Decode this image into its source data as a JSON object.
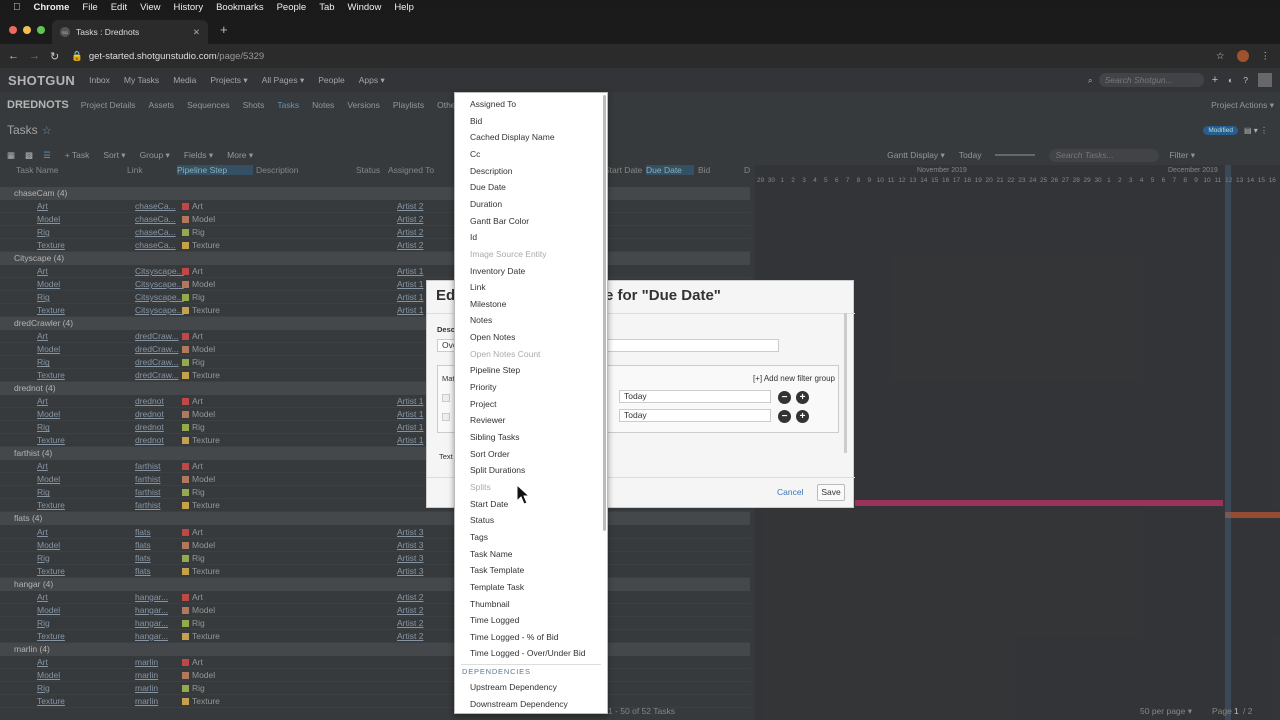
{
  "macbar": {
    "apple": "",
    "app": "Chrome",
    "items": [
      "File",
      "Edit",
      "View",
      "History",
      "Bookmarks",
      "People",
      "Tab",
      "Window",
      "Help"
    ]
  },
  "browser": {
    "tab_title": "Tasks : Drednots",
    "tab_favicon": "SG",
    "url_host": "get-started.shotgunstudio.com",
    "url_path": "/page/5329"
  },
  "topnav": {
    "logo": "SHOTGUN",
    "items": [
      "Inbox",
      "My Tasks",
      "Media",
      "Projects ▾",
      "All Pages ▾",
      "People",
      "Apps ▾"
    ],
    "search_placeholder": "Search Shotgun..."
  },
  "projnav": {
    "project": "DREDNOTS",
    "items": [
      "Project Details",
      "Assets",
      "Sequences",
      "Shots",
      "Tasks",
      "Notes",
      "Versions",
      "Playlists",
      "Othe"
    ],
    "actions": "Project Actions ▾"
  },
  "page": {
    "title": "Tasks",
    "badge": "Modified"
  },
  "toolbar": {
    "items": [
      "+ Task",
      "Sort ▾",
      "Group ▾",
      "Fields ▾",
      "More ▾"
    ],
    "gantt": "Gantt Display ▾",
    "today": "Today",
    "search_placeholder": "Search Tasks...",
    "filter": "Filter ▾"
  },
  "columns": [
    "Task Name",
    "Link",
    "Pipeline Step",
    "Description",
    "Status",
    "Assigned To",
    "Start Date",
    "Due Date",
    "Bid",
    "D"
  ],
  "groups": [
    {
      "name": "chaseCam (4)",
      "link": "chaseCa...",
      "artists": [
        "Artist 2",
        "Artist 2",
        "Artist 2",
        "Artist 2"
      ]
    },
    {
      "name": "Cityscape (4)",
      "link": "Citsyscape...",
      "artists": [
        "Artist 1",
        "Artist 1",
        "Artist 1",
        "Artist 1"
      ]
    },
    {
      "name": "dredCrawler (4)",
      "link": "dredCraw...",
      "artists": [
        "",
        "",
        "",
        ""
      ]
    },
    {
      "name": "drednot (4)",
      "link": "drednot",
      "artists": [
        "Artist 1",
        "Artist 1",
        "Artist 1",
        "Artist 1"
      ]
    },
    {
      "name": "farthist (4)",
      "link": "farthist",
      "artists": [
        "",
        "",
        "",
        ""
      ]
    },
    {
      "name": "flats (4)",
      "link": "flats",
      "artists": [
        "Artist 3",
        "Artist 3",
        "Artist 3",
        "Artist 3"
      ]
    },
    {
      "name": "hangar (4)",
      "link": "hangar...",
      "artists": [
        "Artist 2",
        "Artist 2",
        "Artist 2",
        "Artist 2"
      ]
    },
    {
      "name": "marlin (4)",
      "link": "marlin",
      "artists": [
        "",
        "",
        "",
        ""
      ]
    }
  ],
  "steps": [
    "Art",
    "Model",
    "Rig",
    "Texture"
  ],
  "step_colors": {
    "Art": "#d9534f",
    "Model": "#c98a6a",
    "Rig": "#a9c25b",
    "Texture": "#e0b858"
  },
  "gantt": {
    "month_nov": "November 2019",
    "month_dec": "December 2019",
    "days": [
      "29",
      "30",
      "1",
      "2",
      "3",
      "4",
      "5",
      "6",
      "7",
      "8",
      "9",
      "10",
      "11",
      "12",
      "13",
      "14",
      "15",
      "16",
      "17",
      "18",
      "19",
      "20",
      "21",
      "22",
      "23",
      "24",
      "25",
      "26",
      "27",
      "28",
      "29",
      "30",
      "1",
      "2",
      "3",
      "4",
      "5",
      "6",
      "7",
      "8",
      "9",
      "10",
      "11",
      "12",
      "13",
      "14",
      "15",
      "16"
    ]
  },
  "footer": {
    "range": "1 - 50 of 52 Tasks",
    "per_page": "50 per page ▾",
    "page": "Page",
    "page_no": "1",
    "of": "/ 2"
  },
  "dialog": {
    "title_left": "Ed",
    "title_right": "e for \"Due Date\"",
    "desc_label": "Desc",
    "desc_value": "Ove",
    "match_label": "Mat",
    "add_group": "[+] Add new filter group",
    "today1": "Today",
    "today2": "Today",
    "text_label": "Text",
    "cancel": "Cancel",
    "save": "Save"
  },
  "menu": {
    "items": [
      {
        "label": "Assigned To",
        "disabled": false
      },
      {
        "label": "Bid",
        "disabled": false
      },
      {
        "label": "Cached Display Name",
        "disabled": false
      },
      {
        "label": "Cc",
        "disabled": false
      },
      {
        "label": "Description",
        "disabled": false
      },
      {
        "label": "Due Date",
        "disabled": false
      },
      {
        "label": "Duration",
        "disabled": false
      },
      {
        "label": "Gantt Bar Color",
        "disabled": false
      },
      {
        "label": "Id",
        "disabled": false
      },
      {
        "label": "Image Source Entity",
        "disabled": true
      },
      {
        "label": "Inventory Date",
        "disabled": false
      },
      {
        "label": "Link",
        "disabled": false
      },
      {
        "label": "Milestone",
        "disabled": false
      },
      {
        "label": "Notes",
        "disabled": false
      },
      {
        "label": "Open Notes",
        "disabled": false
      },
      {
        "label": "Open Notes Count",
        "disabled": true
      },
      {
        "label": "Pipeline Step",
        "disabled": false
      },
      {
        "label": "Priority",
        "disabled": false
      },
      {
        "label": "Project",
        "disabled": false
      },
      {
        "label": "Reviewer",
        "disabled": false
      },
      {
        "label": "Sibling Tasks",
        "disabled": false
      },
      {
        "label": "Sort Order",
        "disabled": false
      },
      {
        "label": "Split Durations",
        "disabled": false
      },
      {
        "label": "Splits",
        "disabled": true
      },
      {
        "label": "Start Date",
        "disabled": false
      },
      {
        "label": "Status",
        "disabled": false
      },
      {
        "label": "Tags",
        "disabled": false
      },
      {
        "label": "Task Name",
        "disabled": false
      },
      {
        "label": "Task Template",
        "disabled": false
      },
      {
        "label": "Template Task",
        "disabled": false
      },
      {
        "label": "Thumbnail",
        "disabled": false
      },
      {
        "label": "Time Logged",
        "disabled": false
      },
      {
        "label": "Time Logged - % of Bid",
        "disabled": false
      },
      {
        "label": "Time Logged - Over/Under Bid",
        "disabled": false
      }
    ],
    "section": "DEPENDENCIES",
    "dep_items": [
      "Upstream Dependency",
      "Downstream Dependency"
    ]
  }
}
